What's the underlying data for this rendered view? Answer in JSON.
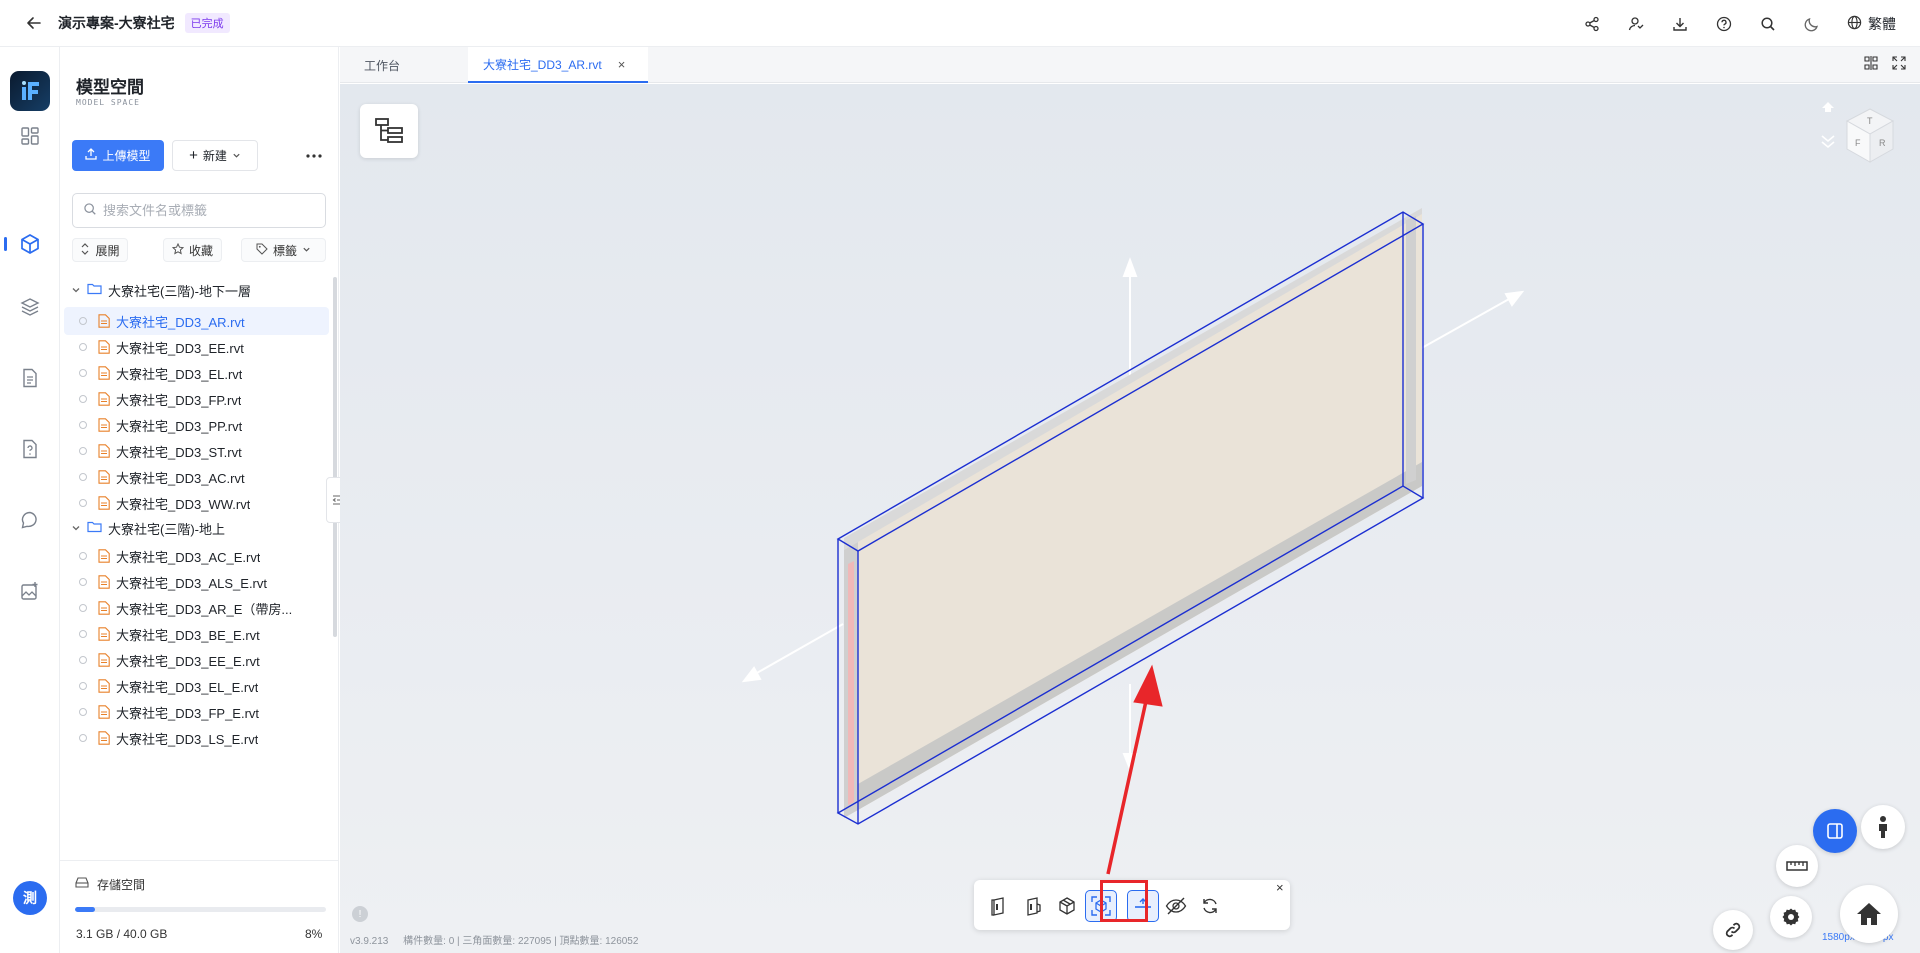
{
  "header": {
    "project_title": "演示專案-大寮社宅",
    "status": "已完成",
    "language": "繁體"
  },
  "rail": {
    "avatar_initial": "測"
  },
  "panel": {
    "title": "模型空間",
    "subtitle": "MODEL SPACE",
    "upload_label": "上傳模型",
    "new_label": "新建",
    "search_placeholder": "搜索文件名或標籤",
    "filters": {
      "expand": "展開",
      "favorite": "收藏",
      "tags": "標籤"
    },
    "folders": [
      {
        "name": "大寮社宅(三階)-地下一層",
        "files": [
          "大寮社宅_DD3_AR.rvt",
          "大寮社宅_DD3_EE.rvt",
          "大寮社宅_DD3_EL.rvt",
          "大寮社宅_DD3_FP.rvt",
          "大寮社宅_DD3_PP.rvt",
          "大寮社宅_DD3_ST.rvt",
          "大寮社宅_DD3_AC.rvt",
          "大寮社宅_DD3_WW.rvt"
        ]
      },
      {
        "name": "大寮社宅(三階)-地上",
        "files": [
          "大寮社宅_DD3_AC_E.rvt",
          "大寮社宅_DD3_ALS_E.rvt",
          "大寮社宅_DD3_AR_E（帶房...",
          "大寮社宅_DD3_BE_E.rvt",
          "大寮社宅_DD3_EE_E.rvt",
          "大寮社宅_DD3_EL_E.rvt",
          "大寮社宅_DD3_FP_E.rvt",
          "大寮社宅_DD3_LS_E.rvt"
        ]
      }
    ],
    "storage": {
      "label": "存儲空間",
      "used": "3.1 GB / 40.0 GB",
      "percent_text": "8%",
      "percent": 8
    }
  },
  "tabs": [
    {
      "label": "工作台",
      "active": false
    },
    {
      "label": "大寮社宅_DD3_AR.rvt",
      "active": true
    }
  ],
  "viewer": {
    "version": "v3.9.213",
    "stats": "構件數量: 0 | 三角面數量: 227095 | 頂點數量: 126052",
    "resolution": "1580px × 869px"
  },
  "colors": {
    "accent": "#2b6cf0",
    "highlight": "#e8262a",
    "badge_text": "#7c3aed"
  }
}
